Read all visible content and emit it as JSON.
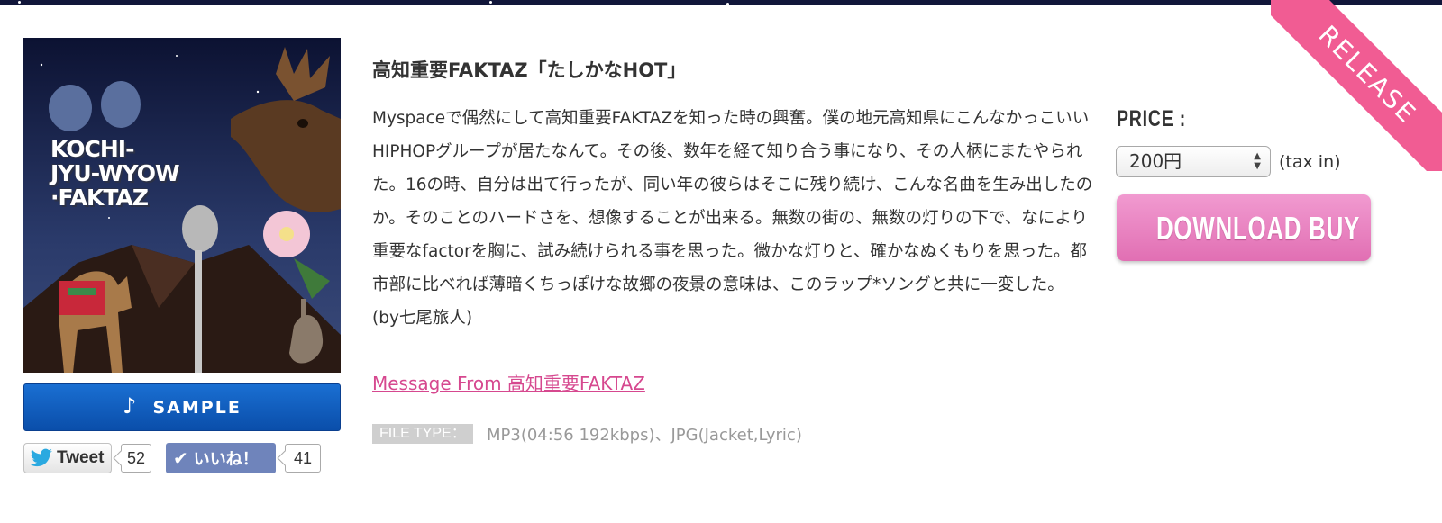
{
  "ribbon": {
    "label": "RELEASE",
    "color": "#f15c93"
  },
  "jacket": {
    "artwork_text": "KOCHI-\nJYU-WYOW\n·FAKTAZ"
  },
  "sample": {
    "label": "SAMPLE",
    "icon": "music-note-icon"
  },
  "social": {
    "tweet_label": "Tweet",
    "tweet_count": "52",
    "like_label": "いいね！",
    "like_count": "41"
  },
  "product": {
    "title": "高知重要FAKTAZ「たしかなHOT」",
    "description": "Myspaceで偶然にして高知重要FAKTAZを知った時の興奮。僕の地元高知県にこんなかっこいいHIPHOPグループが居たなんて。その後、数年を経て知り合う事になり、その人柄にまたやられた。16の時、自分は出て行ったが、同い年の彼らはそこに残り続け、こんな名曲を生み出したのか。そのことのハードさを、想像することが出来る。無数の街の、無数の灯りの下で、なにより重要なfactorを胸に、試み続けられる事を思った。微かな灯りと、確かなぬくもりを思った。都市部に比べれば薄暗くちっぽけな故郷の夜景の意味は、このラップ*ソングと共に一変した。　(by七尾旅人)",
    "message_link": "Message From 高知重要FAKTAZ",
    "file_type_label": "FILE TYPE：",
    "file_type_value": "MP3(04:56 192kbps)、JPG(Jacket,Lyric)"
  },
  "purchase": {
    "price_label": "PRICE :",
    "price_value": "200円",
    "tax_note": "(tax in)",
    "buy_label": "DOWNLOAD BUY"
  },
  "colors": {
    "accent_pink": "#e16fb3",
    "link_pink": "#d6488f",
    "sample_blue": "#0a4eaa",
    "facebook_blue": "#6f84bb",
    "twitter_blue": "#2aa9e0"
  }
}
